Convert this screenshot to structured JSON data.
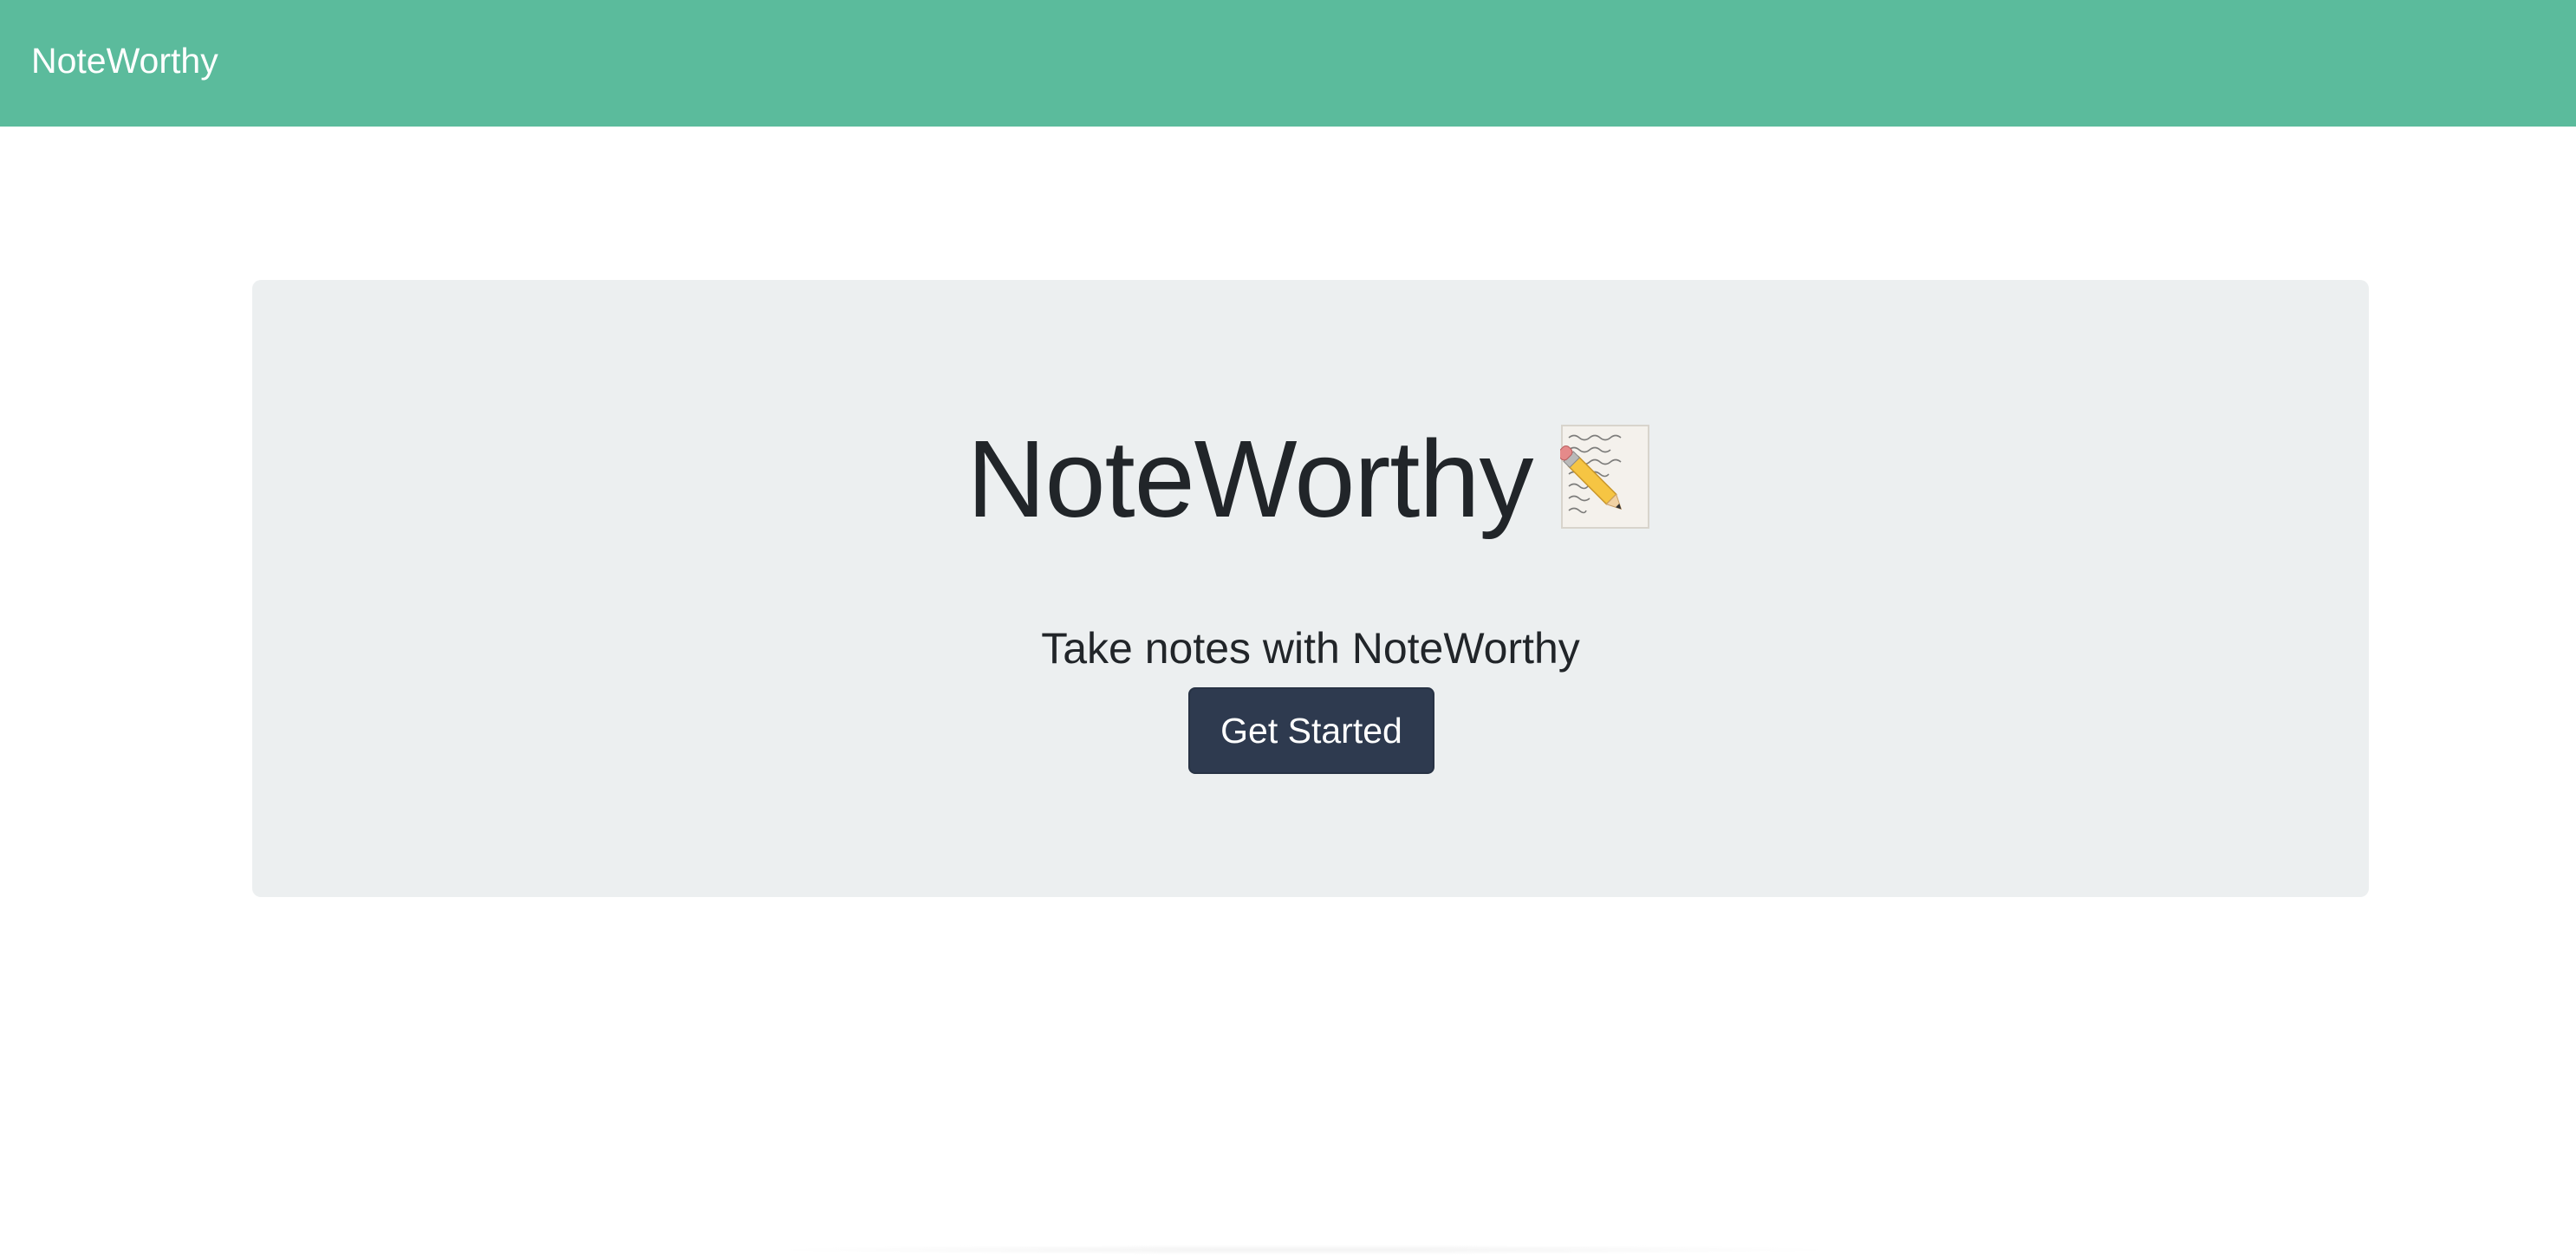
{
  "navbar": {
    "brand": "NoteWorthy",
    "background_color": "#5bbb9c"
  },
  "hero": {
    "title": "NoteWorthy",
    "title_icon": "memo-icon",
    "subtitle": "Take notes with NoteWorthy",
    "cta_label": "Get Started",
    "cta_color": "#2e3a4f",
    "panel_color": "#eceff0"
  }
}
